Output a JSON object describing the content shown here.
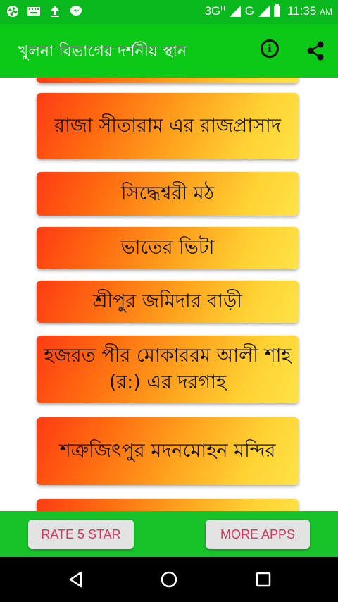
{
  "status_bar": {
    "network": "3G",
    "network_sup": "H",
    "network2": "G",
    "time": "11:35",
    "ampm": "AM",
    "icons": [
      "pinwheel-icon",
      "keyboard-icon",
      "upload-icon",
      "messenger-icon"
    ]
  },
  "app_bar": {
    "title": "খুলনা বিভাগের দর্শনীয় স্থান",
    "info_icon": "info-icon",
    "share_icon": "share-icon"
  },
  "list": {
    "items": [
      {
        "label": ""
      },
      {
        "label": "রাজা সীতারাম এর রাজপ্রাসাদ"
      },
      {
        "label": "সিদ্ধেশ্বরী মঠ"
      },
      {
        "label": "ভাতের ভিটা"
      },
      {
        "label": "শ্রীপুর জমিদার বাড়ী"
      },
      {
        "label": "হজরত পীর মোকাররম আলী শাহ (র:) এর দরগাহ"
      },
      {
        "label": "শত্রুজিৎপুর মদনমোহন মন্দির"
      },
      {
        "label": ""
      }
    ]
  },
  "bottom_bar": {
    "rate_label": "RATE 5 STAR",
    "more_label": "MORE APPS"
  },
  "colors": {
    "status_bar": "#08b81d",
    "app_bar": "#0bc916",
    "bottom_bar": "#18c32a",
    "button_text": "#d8335f",
    "card_start": "#ff3b14",
    "card_end": "#ffe347"
  }
}
